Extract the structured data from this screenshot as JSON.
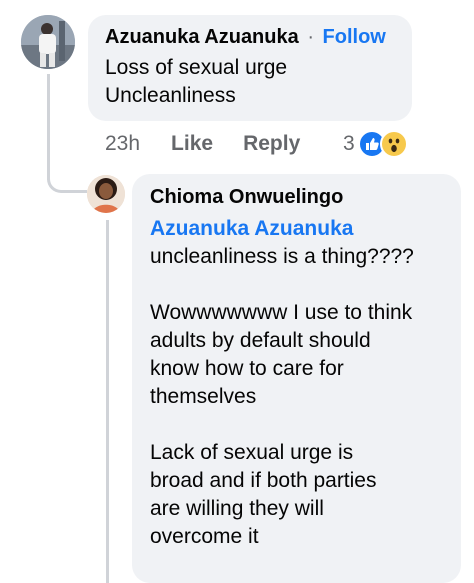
{
  "comment": {
    "author": "Azuanuka Azuanuka",
    "separator": "·",
    "follow_label": "Follow",
    "lines": [
      "Loss of sexual urge",
      "Uncleanliness"
    ],
    "time": "23h",
    "like_label": "Like",
    "reply_label": "Reply",
    "reaction_count": "3",
    "reactions": [
      "like-icon",
      "wow-icon"
    ]
  },
  "reply": {
    "author": "Chioma Onwuelingo",
    "mention": "Azuanuka Azuanuka",
    "paragraphs": [
      [
        "uncleanliness is a thing????"
      ],
      [
        "Wowwwwwww I use to think",
        "adults by default should",
        "know how to care for",
        "themselves"
      ],
      [
        "Lack of sexual urge is",
        "broad and if both parties",
        "are willing they will",
        "overcome it"
      ]
    ]
  },
  "colors": {
    "bubble": "#f0f2f5",
    "link": "#1877f2",
    "meta": "#65676b"
  }
}
